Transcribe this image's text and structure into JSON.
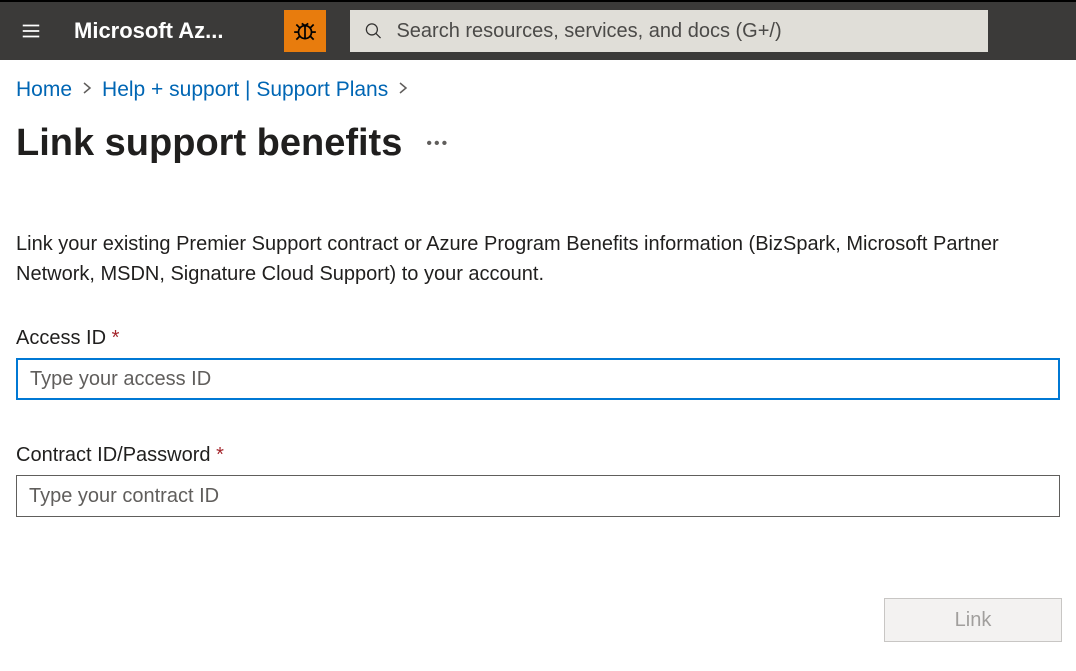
{
  "header": {
    "brand": "Microsoft Az...",
    "searchPlaceholder": "Search resources, services, and docs (G+/)"
  },
  "breadcrumb": {
    "home": "Home",
    "helpSupport": "Help + support | Support Plans"
  },
  "page": {
    "title": "Link support benefits",
    "description": "Link your existing Premier Support contract or Azure Program Benefits information (BizSpark, Microsoft Partner Network, MSDN, Signature Cloud Support) to your account."
  },
  "form": {
    "accessId": {
      "label": "Access ID",
      "placeholder": "Type your access ID"
    },
    "contractId": {
      "label": "Contract ID/Password",
      "placeholder": "Type your contract ID"
    }
  },
  "footer": {
    "linkButton": "Link"
  }
}
